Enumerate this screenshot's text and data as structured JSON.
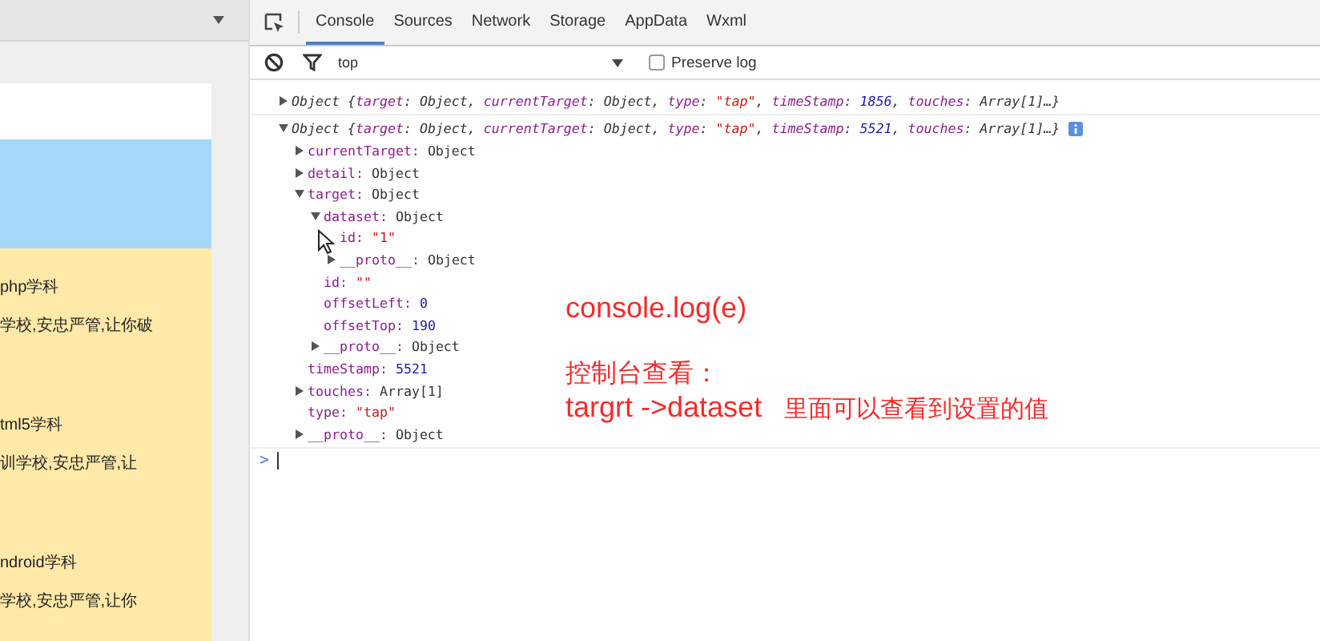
{
  "simulator": {
    "items": [
      {
        "title": "php学科",
        "desc": "学校,安忠严管,让你破"
      },
      {
        "title": "tml5学科",
        "desc": "训学校,安忠严管,让"
      },
      {
        "title": "ndroid学科",
        "desc": "学校,安忠严管,让你"
      }
    ]
  },
  "devtools": {
    "tabs": [
      {
        "label": "Console",
        "selected": true
      },
      {
        "label": "Sources",
        "selected": false
      },
      {
        "label": "Network",
        "selected": false
      },
      {
        "label": "Storage",
        "selected": false
      },
      {
        "label": "AppData",
        "selected": false
      },
      {
        "label": "Wxml",
        "selected": false
      }
    ],
    "context": "top",
    "preserve_log": {
      "label": "Preserve log",
      "checked": false
    },
    "logs": [
      {
        "expanded": false,
        "info": false,
        "summary": [
          {
            "t": "Object {",
            "kind": "plain"
          },
          {
            "t": "target",
            "kind": "key"
          },
          {
            "t": ": Object, ",
            "kind": "plain"
          },
          {
            "t": "currentTarget",
            "kind": "key"
          },
          {
            "t": ": Object, ",
            "kind": "plain"
          },
          {
            "t": "type",
            "kind": "key"
          },
          {
            "t": ": ",
            "kind": "plain"
          },
          {
            "t": "\"tap\"",
            "kind": "string"
          },
          {
            "t": ", ",
            "kind": "plain"
          },
          {
            "t": "timeStamp",
            "kind": "key"
          },
          {
            "t": ": ",
            "kind": "plain"
          },
          {
            "t": "1856",
            "kind": "number"
          },
          {
            "t": ", ",
            "kind": "plain"
          },
          {
            "t": "touches",
            "kind": "key"
          },
          {
            "t": ": Array[1]…}",
            "kind": "plain"
          }
        ]
      },
      {
        "expanded": true,
        "info": true,
        "summary": [
          {
            "t": "Object {",
            "kind": "plain"
          },
          {
            "t": "target",
            "kind": "key"
          },
          {
            "t": ": Object, ",
            "kind": "plain"
          },
          {
            "t": "currentTarget",
            "kind": "key"
          },
          {
            "t": ": Object, ",
            "kind": "plain"
          },
          {
            "t": "type",
            "kind": "key"
          },
          {
            "t": ": ",
            "kind": "plain"
          },
          {
            "t": "\"tap\"",
            "kind": "string"
          },
          {
            "t": ", ",
            "kind": "plain"
          },
          {
            "t": "timeStamp",
            "kind": "key"
          },
          {
            "t": ": ",
            "kind": "plain"
          },
          {
            "t": "5521",
            "kind": "number"
          },
          {
            "t": ", ",
            "kind": "plain"
          },
          {
            "t": "touches",
            "kind": "key"
          },
          {
            "t": ": Array[1]…}",
            "kind": "plain"
          }
        ],
        "children": [
          {
            "key": "currentTarget:",
            "value": "Object",
            "kind": "object",
            "expanded": false
          },
          {
            "key": "detail:",
            "value": "Object",
            "kind": "object",
            "expanded": false
          },
          {
            "key": "target:",
            "value": "Object",
            "kind": "object",
            "expanded": true,
            "children": [
              {
                "key": "dataset:",
                "value": "Object",
                "kind": "object",
                "expanded": true,
                "children": [
                  {
                    "key": "id:",
                    "value": "\"1\"",
                    "kind": "string"
                  },
                  {
                    "key": "__proto__:",
                    "value": "Object",
                    "kind": "object",
                    "expanded": false
                  }
                ]
              },
              {
                "key": "id:",
                "value": "\"\"",
                "kind": "string"
              },
              {
                "key": "offsetLeft:",
                "value": "0",
                "kind": "number"
              },
              {
                "key": "offsetTop:",
                "value": "190",
                "kind": "number"
              },
              {
                "key": "__proto__:",
                "value": "Object",
                "kind": "object",
                "expanded": false
              }
            ]
          },
          {
            "key": "timeStamp:",
            "value": "5521",
            "kind": "number"
          },
          {
            "key": "touches:",
            "value": "Array[1]",
            "kind": "object",
            "expanded": false
          },
          {
            "key": "type:",
            "value": "\"tap\"",
            "kind": "string"
          },
          {
            "key": "__proto__:",
            "value": "Object",
            "kind": "object",
            "expanded": false
          }
        ]
      }
    ],
    "prompt": ">"
  },
  "annotations": [
    {
      "text": "console.log(e)",
      "kind": "title"
    },
    {
      "text": "控制台查看：",
      "kind": "note"
    },
    {
      "text": "targrt ->dataset",
      "kind": "title",
      "suffix": "里面可以查看到设置的值"
    }
  ]
}
